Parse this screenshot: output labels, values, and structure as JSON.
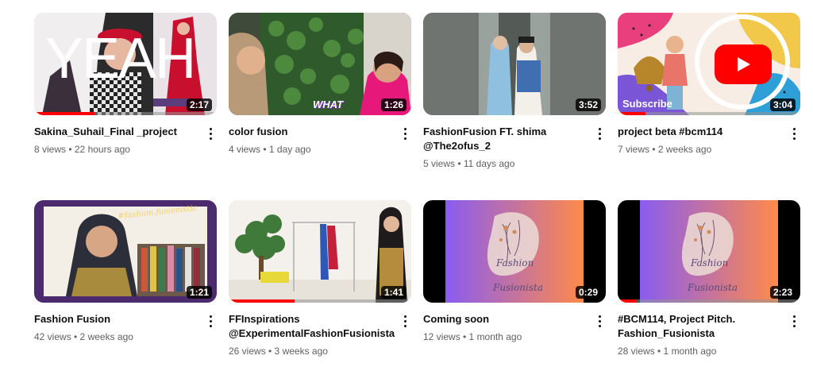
{
  "videos": [
    {
      "title": "Sakina_Suhail_Final _project",
      "stats": "8 views • 22 hours ago",
      "duration": "2:17",
      "progress": 0.33,
      "overlay": "YEAH"
    },
    {
      "title": "color fusion",
      "stats": "4 views • 1 day ago",
      "duration": "1:26",
      "progress": 0,
      "overlay": "WHAT"
    },
    {
      "title": "FashionFusion FT. shima\n@The2ofus_2",
      "stats": "5 views • 11 days ago",
      "duration": "3:52",
      "progress": 0
    },
    {
      "title": "project beta #bcm114",
      "stats": "7 views • 2 weeks ago",
      "duration": "3:04",
      "progress": 0.15,
      "overlay": "Subscribe"
    },
    {
      "title": "Fashion Fusion",
      "stats": "42 views • 2 weeks ago",
      "duration": "1:21",
      "progress": 0,
      "overlay": "#fashion.fusionistic"
    },
    {
      "title": "FFInspirations\n@ExperimentalFashionFusionista",
      "stats": "26 views • 3 weeks ago",
      "duration": "1:41",
      "progress": 0.36
    },
    {
      "title": "Coming soon",
      "stats": "12 views • 1 month ago",
      "duration": "0:29",
      "progress": 0,
      "overlay_top": "Fashion",
      "overlay_bottom": "Fusionista"
    },
    {
      "title": "#BCM114, Project Pitch.\nFashion_Fusionista",
      "stats": "28 views • 1 month ago",
      "duration": "2:23",
      "progress": 0.1,
      "overlay_top": "Fashion",
      "overlay_bottom": "Fusionista"
    }
  ],
  "colors": {
    "progress": "#ff0000",
    "text_primary": "#0f0f0f",
    "text_secondary": "#606060",
    "youtube_red": "#ff0000"
  },
  "icons": {
    "menu": "more-vert-icon",
    "play": "youtube-play-icon"
  }
}
